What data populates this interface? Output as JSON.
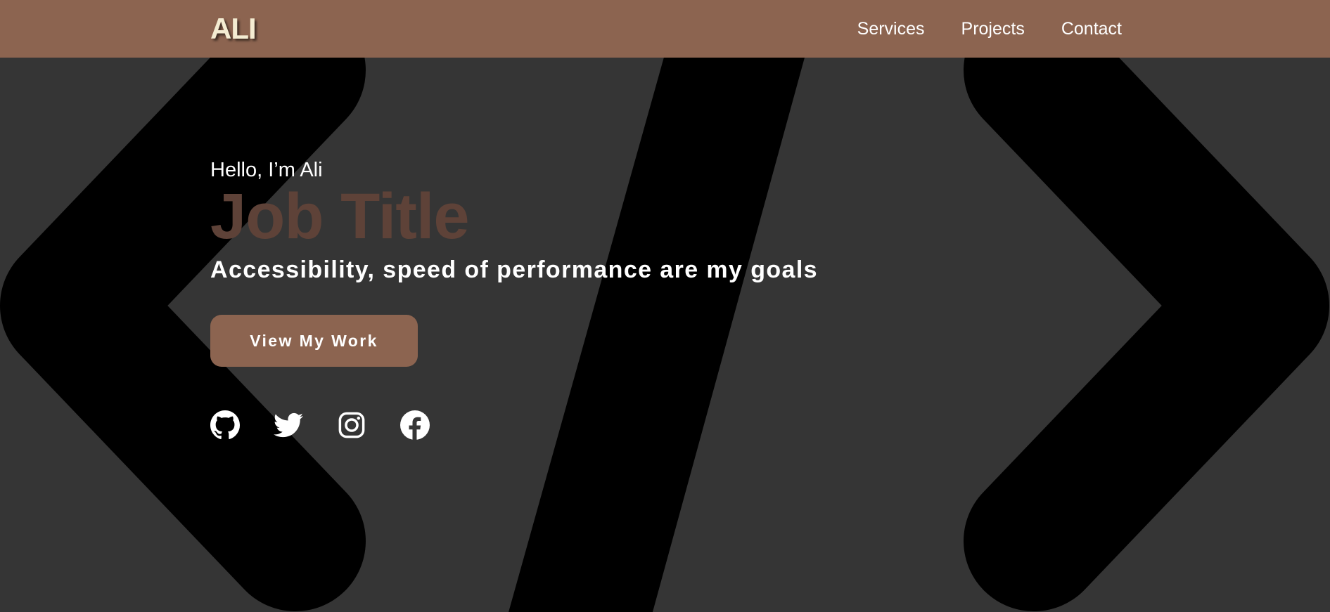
{
  "header": {
    "logo": "ALI",
    "nav": [
      {
        "label": "Services"
      },
      {
        "label": "Projects"
      },
      {
        "label": "Contact"
      }
    ]
  },
  "hero": {
    "greeting": "Hello, I’m Ali",
    "job_title": "Job Title",
    "tagline": "Accessibility, speed of performance are my goals",
    "cta_label": "View My Work"
  },
  "socials": [
    {
      "icon": "github-icon"
    },
    {
      "icon": "twitter-icon"
    },
    {
      "icon": "instagram-icon"
    },
    {
      "icon": "facebook-icon"
    }
  ],
  "colors": {
    "header_bg": "#8c6450",
    "page_bg": "#353535",
    "job_title": "#5e4238",
    "logo": "#f4ecd2",
    "glyph": "#000000"
  },
  "background": {
    "glyph": "code-brackets-icon"
  }
}
